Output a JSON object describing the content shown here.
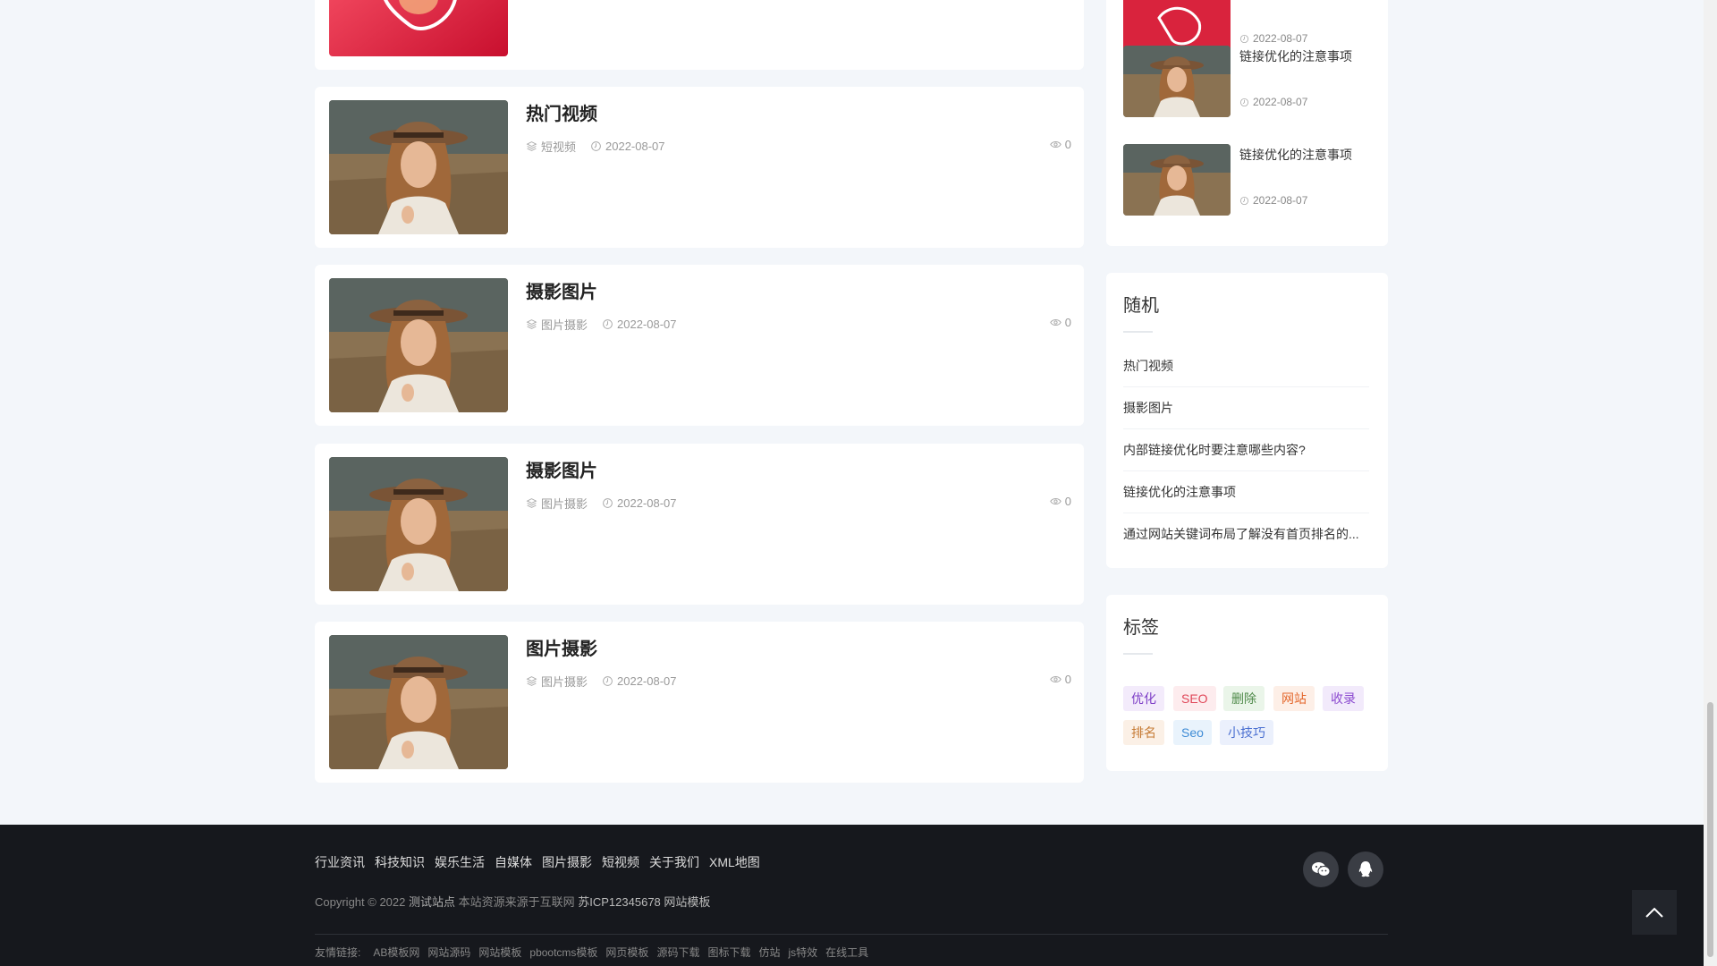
{
  "posts": [
    {
      "title": "热门视频",
      "category": "短视频",
      "date": "2022-08-07",
      "views": "0"
    },
    {
      "title": "摄影图片",
      "category": "图片摄影",
      "date": "2022-08-07",
      "views": "0"
    },
    {
      "title": "摄影图片",
      "category": "图片摄影",
      "date": "2022-08-07",
      "views": "0"
    },
    {
      "title": "图片摄影",
      "category": "图片摄影",
      "date": "2022-08-07",
      "views": "0"
    }
  ],
  "sidebar": {
    "top_partial_date": "2022-08-07",
    "side_posts": [
      {
        "title": "链接优化的注意事项",
        "date": "2022-08-07"
      },
      {
        "title": "链接优化的注意事项",
        "date": "2022-08-07"
      }
    ],
    "random": {
      "title": "随机",
      "items": [
        "热门视频",
        "摄影图片",
        "内部链接优化时要注意哪些内容?",
        "链接优化的注意事项",
        "通过网站关键词布局了解没有首页排名的..."
      ]
    },
    "tags": {
      "title": "标签",
      "items": [
        {
          "label": "优化",
          "color": "#7d3ec7",
          "bg": "#f3ebfb"
        },
        {
          "label": "SEO",
          "color": "#e0485a",
          "bg": "#fdecee"
        },
        {
          "label": "删除",
          "color": "#4f8a4a",
          "bg": "#eaf5e9"
        },
        {
          "label": "网站",
          "color": "#e4672c",
          "bg": "#fdefe7"
        },
        {
          "label": "收录",
          "color": "#8c4bd0",
          "bg": "#f2eafb"
        },
        {
          "label": "排名",
          "color": "#c67a34",
          "bg": "#fbf0e6"
        },
        {
          "label": "Seo",
          "color": "#3f8cd6",
          "bg": "#e9f3fc"
        },
        {
          "label": "小技巧",
          "color": "#4a6fd1",
          "bg": "#ebf0fc"
        }
      ]
    }
  },
  "footer": {
    "nav": [
      "行业资讯",
      "科技知识",
      "娱乐生活",
      "自媒体",
      "图片摄影",
      "短视频",
      "关于我们",
      "XML地图"
    ],
    "copyright_prefix": "Copyright © 2022",
    "site_name": "测试站点",
    "copyright_mid": "本站资源来源于互联网",
    "icp": "苏ICP12345678",
    "template": "网站模板",
    "links_label": "友情链接:",
    "links": [
      "AB模板网",
      "网站源码",
      "网站模板",
      "pbootcms模板",
      "网页模板",
      "源码下载",
      "图标下载",
      "仿站",
      "js特效",
      "在线工具"
    ]
  }
}
